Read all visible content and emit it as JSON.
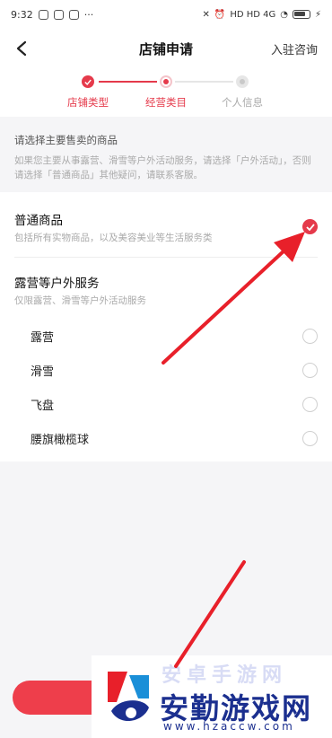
{
  "status_bar": {
    "time": "9:32",
    "more": "···",
    "right_text": "HD HD 4G"
  },
  "nav": {
    "title": "店铺申请",
    "consult": "入驻咨询"
  },
  "steps": [
    {
      "label": "店铺类型",
      "state": "done"
    },
    {
      "label": "经营类目",
      "state": "active"
    },
    {
      "label": "个人信息",
      "state": "todo"
    }
  ],
  "notice": {
    "title": "请选择主要售卖的商品",
    "detail": "如果您主要从事露营、滑雪等户外活动服务，请选择「户外活动」，否则请选择「普通商品」其他疑问，请联系客服。"
  },
  "options": {
    "general": {
      "title": "普通商品",
      "desc": "包括所有实物商品，以及美容美业等生活服务类",
      "checked": true
    },
    "outdoor": {
      "title": "露营等户外服务",
      "desc": "仅限露营、滑雪等户外活动服务",
      "items": [
        "露营",
        "滑雪",
        "飞盘",
        "腰旗橄榄球"
      ]
    }
  },
  "watermark": {
    "top_text": "安卓手游网",
    "name": "安勤游戏网",
    "url": "www.hzaccw.com"
  },
  "colors": {
    "accent": "#e53a4b",
    "arrow": "#e8202a",
    "watermark_blue": "#1b2f8f"
  }
}
